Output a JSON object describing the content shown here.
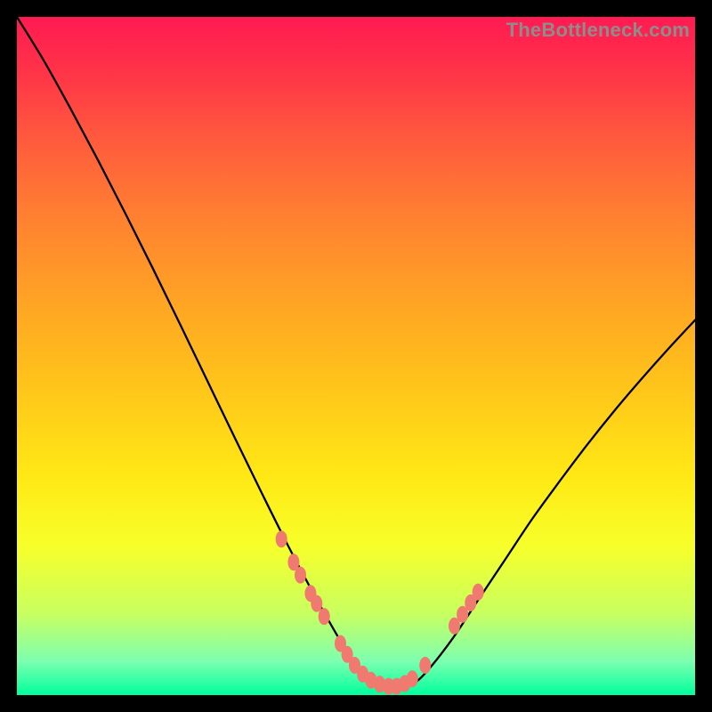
{
  "watermark": "TheBottleneck.com",
  "colors": {
    "frame": "#000000",
    "curve": "#000000",
    "marker_fill": "#f07970",
    "marker_stroke": "#e56a62"
  },
  "chart_data": {
    "type": "line",
    "title": "",
    "xlabel": "",
    "ylabel": "",
    "xlim": [
      0,
      100
    ],
    "ylim": [
      0,
      100
    ],
    "series": [
      {
        "name": "bottleneck-curve",
        "x": [
          0,
          4,
          8,
          12,
          16,
          20,
          24,
          28,
          32,
          36,
          40,
          44,
          48,
          50,
          52,
          54,
          56,
          58,
          60,
          64,
          68,
          72,
          76,
          80,
          84,
          88,
          92,
          96,
          100
        ],
        "y": [
          100,
          93.5,
          86.3,
          78.8,
          71.0,
          63.0,
          54.8,
          46.5,
          38.2,
          30.0,
          22.0,
          14.5,
          7.5,
          4.5,
          2.5,
          1.5,
          1.0,
          1.5,
          3.0,
          8.0,
          14.0,
          20.0,
          26.0,
          31.5,
          36.8,
          41.8,
          46.5,
          51.0,
          55.3
        ]
      }
    ],
    "markers": {
      "name": "highlight-dots",
      "points": [
        {
          "x": 39.0,
          "y": 23.0
        },
        {
          "x": 40.8,
          "y": 19.6
        },
        {
          "x": 41.8,
          "y": 17.7
        },
        {
          "x": 43.3,
          "y": 15.0
        },
        {
          "x": 44.2,
          "y": 13.5
        },
        {
          "x": 45.3,
          "y": 11.6
        },
        {
          "x": 47.7,
          "y": 7.6
        },
        {
          "x": 48.7,
          "y": 6.0
        },
        {
          "x": 49.8,
          "y": 4.4
        },
        {
          "x": 51.0,
          "y": 3.1
        },
        {
          "x": 52.2,
          "y": 2.2
        },
        {
          "x": 53.5,
          "y": 1.6
        },
        {
          "x": 54.8,
          "y": 1.3
        },
        {
          "x": 56.0,
          "y": 1.3
        },
        {
          "x": 57.2,
          "y": 1.7
        },
        {
          "x": 58.3,
          "y": 2.4
        },
        {
          "x": 60.2,
          "y": 4.4
        },
        {
          "x": 64.5,
          "y": 10.2
        },
        {
          "x": 65.7,
          "y": 11.9
        },
        {
          "x": 66.9,
          "y": 13.6
        },
        {
          "x": 68.0,
          "y": 15.2
        }
      ]
    }
  }
}
